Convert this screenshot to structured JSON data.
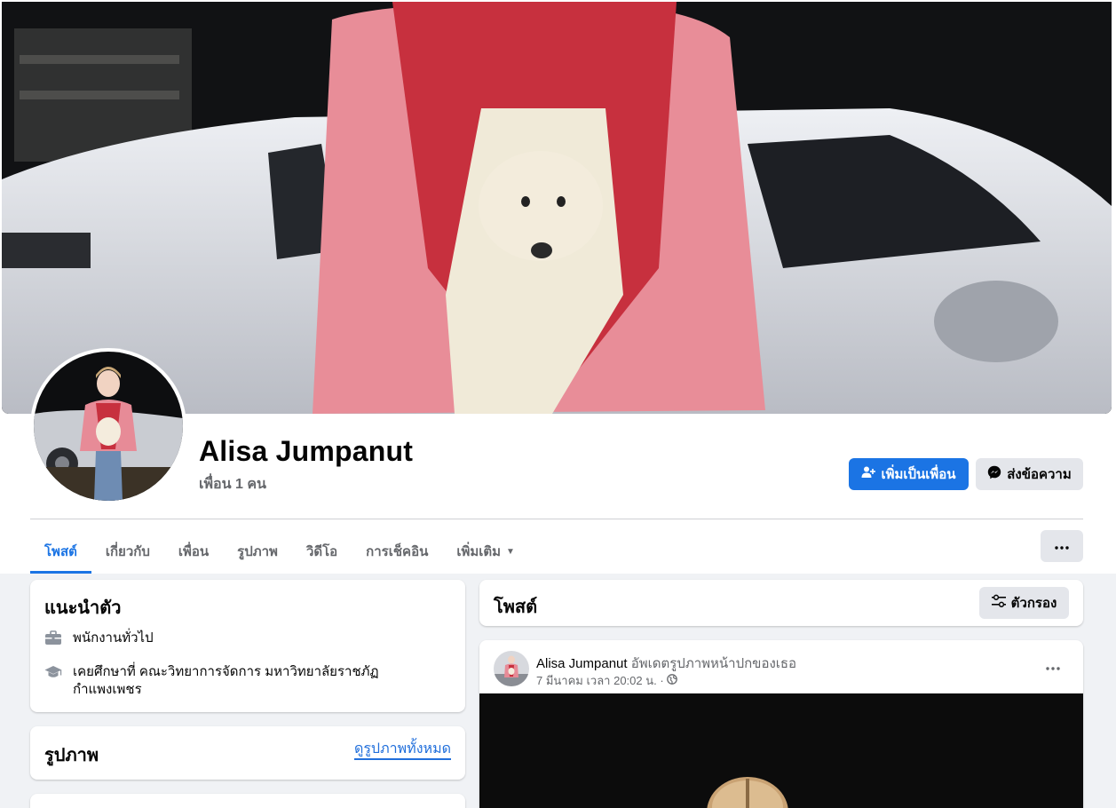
{
  "profile": {
    "name": "Alisa Jumpanut",
    "friends": "เพื่อน 1 คน"
  },
  "actions": {
    "add_friend": "เพิ่มเป็นเพื่อน",
    "message": "ส่งข้อความ"
  },
  "tabs": [
    {
      "label": "โพสต์",
      "active": true
    },
    {
      "label": "เกี่ยวกับ"
    },
    {
      "label": "เพื่อน"
    },
    {
      "label": "รูปภาพ"
    },
    {
      "label": "วิดีโอ"
    },
    {
      "label": "การเช็คอิน"
    },
    {
      "label": "เพิ่มเติม"
    }
  ],
  "intro": {
    "title": "แนะนำตัว",
    "work": "พนักงานทั่วไป",
    "education": "เคยศึกษาที่ คณะวิทยาการจัดการ มหาวิทยาลัยราชภัฏกำแพงเพชร"
  },
  "photos": {
    "title": "รูปภาพ",
    "see_all": "ดูรูปภาพทั้งหมด"
  },
  "posts": {
    "title": "โพสต์",
    "filter": "ตัวกรอง"
  },
  "post": {
    "author": "Alisa Jumpanut",
    "action": "อัพเดตรูปภาพหน้าปกของเธอ",
    "timestamp": "7 มีนาคม เวลา 20:02 น. ·"
  },
  "colors": {
    "accent": "#1b74e4",
    "secondary_button": "#e4e6eb",
    "page_background": "#f0f2f5",
    "muted_text": "#65676b"
  },
  "icons": {
    "add_friend": "person-plus-icon",
    "message": "messenger-icon",
    "more": "more-dots-icon",
    "work": "briefcase-icon",
    "education": "graduation-cap-icon",
    "filter": "filter-sliders-icon",
    "privacy": "globe-icon"
  }
}
